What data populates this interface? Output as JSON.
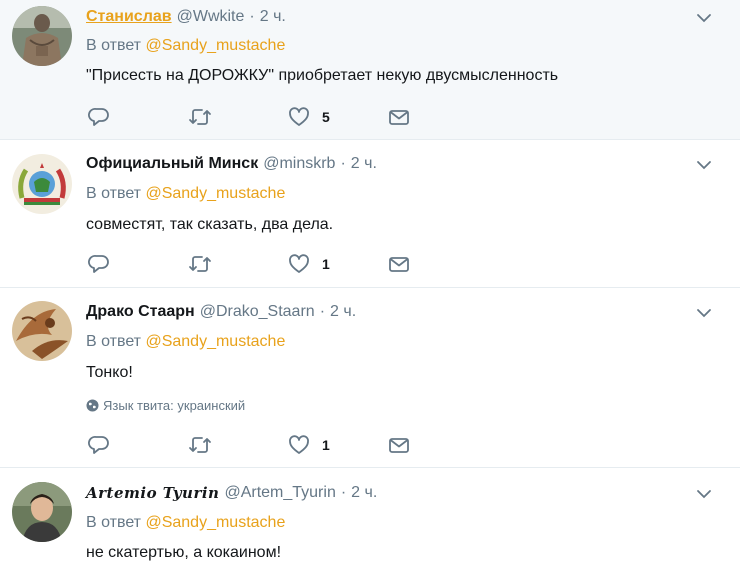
{
  "reply_prefix": "В ответ",
  "mention": "@Sandy_mustache",
  "tweets": [
    {
      "name": "Станислав",
      "handle": "@Wwkite",
      "sep": "·",
      "time": "2 ч.",
      "text": "\"Присесть на ДОРОЖКУ\" приобретает некую двусмысленность",
      "like_count": "5"
    },
    {
      "name": "Официальный Минск",
      "handle": "@minskrb",
      "sep": "·",
      "time": "2 ч.",
      "text": "совместят, так сказать, два дела.",
      "like_count": "1"
    },
    {
      "name": "Драко Стаарн",
      "handle": "@Drako_Staarn",
      "sep": "·",
      "time": "2 ч.",
      "text": "Тонко!",
      "language": "Язык твита: украинский",
      "like_count": "1"
    },
    {
      "name": "Artemio Tyurin",
      "handle": "@Artem_Tyurin",
      "sep": "·",
      "time": "2 ч.",
      "text": "не скатертью, а кокаином!"
    }
  ],
  "colors": {
    "accent": "#e8a21c",
    "muted": "#657786",
    "highlight_bg": "#f5f8fa",
    "divider": "#e6ecf0"
  },
  "icons": [
    "reply-icon",
    "retweet-icon",
    "like-icon",
    "message-icon",
    "caret-down-icon",
    "globe-icon"
  ]
}
